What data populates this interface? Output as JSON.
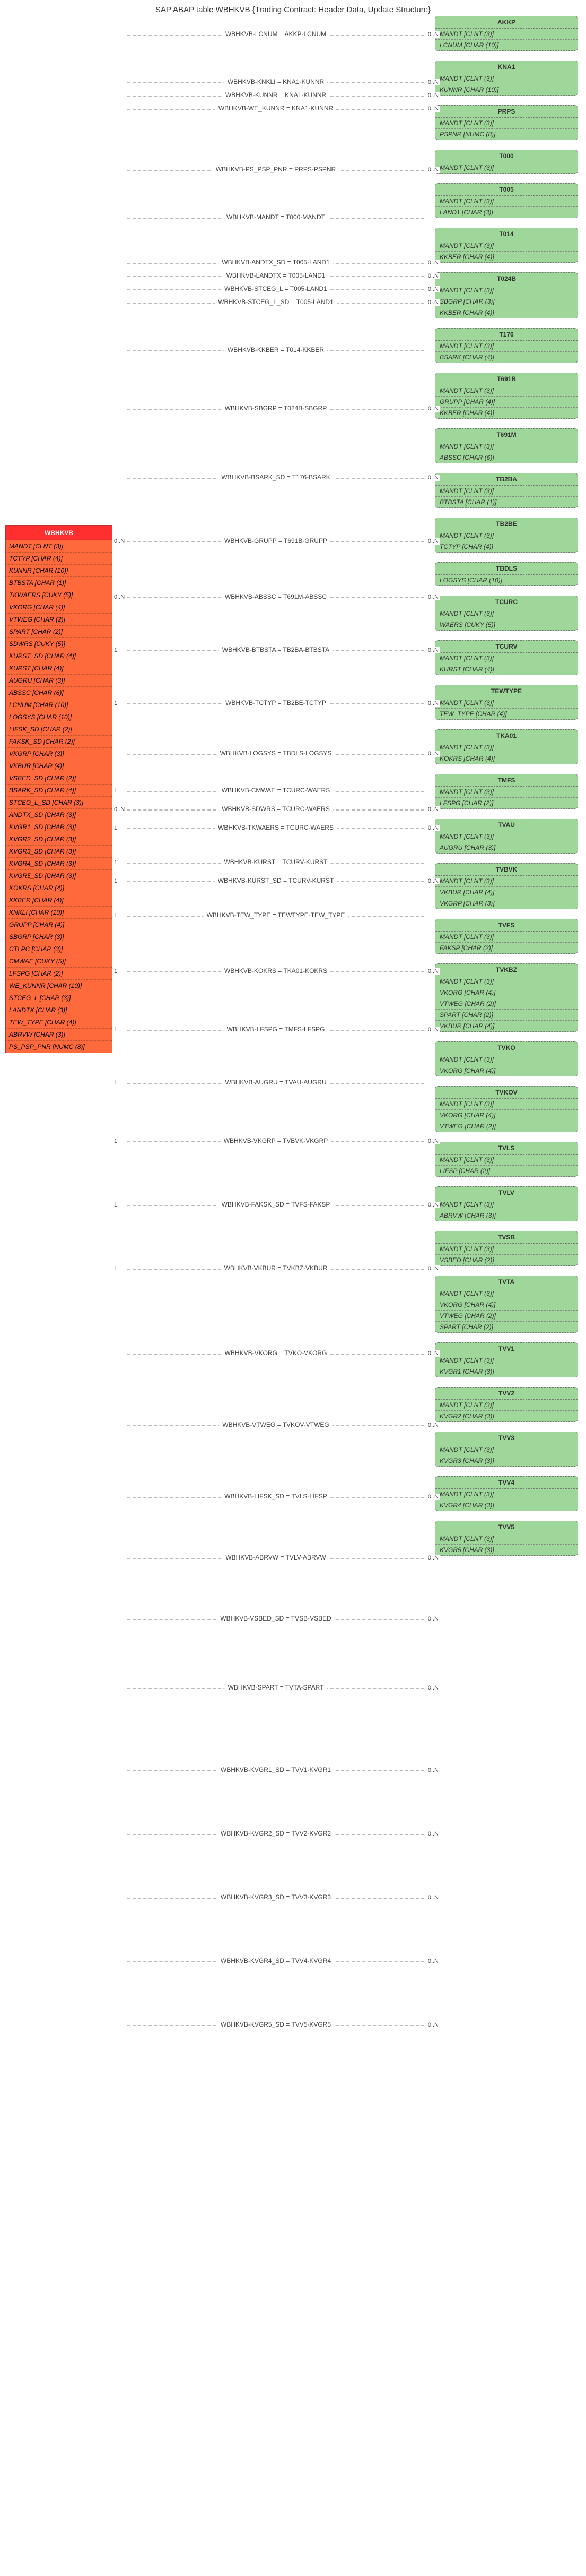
{
  "title": "SAP ABAP table WBHKVB {Trading Contract: Header Data, Update Structure}",
  "source_table": {
    "name": "WBHKVB",
    "fields": [
      "MANDT [CLNT (3)]",
      "TCTYP [CHAR (4)]",
      "KUNNR [CHAR (10)]",
      "BTBSTA [CHAR (1)]",
      "TKWAERS [CUKY (5)]",
      "VKORG [CHAR (4)]",
      "VTWEG [CHAR (2)]",
      "SPART [CHAR (2)]",
      "SDWRS [CUKY (5)]",
      "KURST_SD [CHAR (4)]",
      "KURST [CHAR (4)]",
      "AUGRU [CHAR (3)]",
      "ABSSC [CHAR (6)]",
      "LCNUM [CHAR (10)]",
      "LOGSYS [CHAR (10)]",
      "LIFSK_SD [CHAR (2)]",
      "FAKSK_SD [CHAR (2)]",
      "VKGRP [CHAR (3)]",
      "VKBUR [CHAR (4)]",
      "VSBED_SD [CHAR (2)]",
      "BSARK_SD [CHAR (4)]",
      "STCEG_L_SD [CHAR (3)]",
      "ANDTX_SD [CHAR (3)]",
      "KVGR1_SD [CHAR (3)]",
      "KVGR2_SD [CHAR (3)]",
      "KVGR3_SD [CHAR (3)]",
      "KVGR4_SD [CHAR (3)]",
      "KVGR5_SD [CHAR (3)]",
      "KOKRS [CHAR (4)]",
      "KKBER [CHAR (4)]",
      "KNKLI [CHAR (10)]",
      "GRUPP [CHAR (4)]",
      "SBGRP [CHAR (3)]",
      "CTLPC [CHAR (3)]",
      "CMWAE [CUKY (5)]",
      "LFSPG [CHAR (2)]",
      "WE_KUNNR [CHAR (10)]",
      "STCEG_L [CHAR (3)]",
      "LANDTX [CHAR (3)]",
      "TEW_TYPE [CHAR (4)]",
      "ABRVW [CHAR (3)]",
      "PS_PSP_PNR [NUMC (8)]"
    ]
  },
  "edges": [
    {
      "label": "WBHKVB-LCNUM = AKKP-LCNUM",
      "card_right": "0..N",
      "target": "AKKP"
    },
    {
      "label": "WBHKVB-KNKLI = KNA1-KUNNR",
      "card_right": "0..N",
      "target": "KNA1"
    },
    {
      "label": "WBHKVB-KUNNR = KNA1-KUNNR",
      "card_left": "",
      "card_right": "0..N",
      "target": "KNA1"
    },
    {
      "label": "WBHKVB-WE_KUNNR = KNA1-KUNNR",
      "card_right": "0..N",
      "target": "KNA1"
    },
    {
      "label": "WBHKVB-PS_PSP_PNR = PRPS-PSPNR",
      "card_right": "0..N",
      "target": "PRPS"
    },
    {
      "label": "WBHKVB-MANDT = T000-MANDT",
      "card_right": "",
      "target": "T000"
    },
    {
      "label": "WBHKVB-ANDTX_SD = T005-LAND1",
      "card_right": "0..N",
      "target": "T005"
    },
    {
      "label": "WBHKVB-LANDTX = T005-LAND1",
      "card_right": "0..N",
      "target": "T005"
    },
    {
      "label": "WBHKVB-STCEG_L = T005-LAND1",
      "card_right": "0..N",
      "target": "T005"
    },
    {
      "label": "WBHKVB-STCEG_L_SD = T005-LAND1",
      "card_right": "0..N",
      "target": "T005"
    },
    {
      "label": "WBHKVB-KKBER = T014-KKBER",
      "card_right": "",
      "target": "T014"
    },
    {
      "label": "WBHKVB-SBGRP = T024B-SBGRP",
      "card_right": "0..N",
      "target": "T024B"
    },
    {
      "label": "WBHKVB-BSARK_SD = T176-BSARK",
      "card_right": "0..N",
      "target": "T176"
    },
    {
      "label": "WBHKVB-GRUPP = T691B-GRUPP",
      "card_left": "0..N",
      "card_right": "0..N",
      "target": "T691B"
    },
    {
      "label": "WBHKVB-ABSSC = T691M-ABSSC",
      "card_left": "0..N",
      "card_right": "0..N",
      "target": "T691M"
    },
    {
      "label": "WBHKVB-BTBSTA = TB2BA-BTBSTA",
      "card_left": "1",
      "card_right": "0..N",
      "target": "TB2BA"
    },
    {
      "label": "WBHKVB-TCTYP = TB2BE-TCTYP",
      "card_left": "1",
      "card_right": "0..N",
      "target": "TB2BE"
    },
    {
      "label": "WBHKVB-LOGSYS = TBDLS-LOGSYS",
      "card_left": "",
      "card_right": "0..N",
      "target": "TBDLS"
    },
    {
      "label": "WBHKVB-CMWAE = TCURC-WAERS",
      "card_left": "1",
      "card_right": "",
      "target": "TCURC"
    },
    {
      "label": "WBHKVB-SDWRS = TCURC-WAERS",
      "card_left": "0..N",
      "card_right": "0..N",
      "target": "TCURC"
    },
    {
      "label": "WBHKVB-TKWAERS = TCURC-WAERS",
      "card_left": "1",
      "card_right": "0..N",
      "target": "TCURC"
    },
    {
      "label": "WBHKVB-KURST = TCURV-KURST",
      "card_left": "1",
      "card_right": "",
      "target": "TCURV"
    },
    {
      "label": "WBHKVB-KURST_SD = TCURV-KURST",
      "card_left": "1",
      "card_right": "0..N",
      "target": "TCURV"
    },
    {
      "label": "WBHKVB-TEW_TYPE = TEWTYPE-TEW_TYPE",
      "card_left": "1",
      "card_right": "",
      "target": "TEWTYPE"
    },
    {
      "label": "WBHKVB-KOKRS = TKA01-KOKRS",
      "card_left": "1",
      "card_right": "0..N",
      "target": "TKA01"
    },
    {
      "label": "WBHKVB-LFSPG = TMFS-LFSPG",
      "card_left": "1",
      "card_right": "0..N",
      "target": "TMFS"
    },
    {
      "label": "WBHKVB-AUGRU = TVAU-AUGRU",
      "card_left": "1",
      "card_right": "",
      "target": "TVAU"
    },
    {
      "label": "WBHKVB-VKGRP = TVBVK-VKGRP",
      "card_left": "1",
      "card_right": "0..N",
      "target": "TVBVK"
    },
    {
      "label": "WBHKVB-FAKSK_SD = TVFS-FAKSP",
      "card_left": "1",
      "card_right": "0..N",
      "target": "TVFS"
    },
    {
      "label": "WBHKVB-VKBUR = TVKBZ-VKBUR",
      "card_left": "1",
      "card_right": "0..N",
      "target": "TVKBZ"
    },
    {
      "label": "WBHKVB-VKORG = TVKO-VKORG",
      "card_left": "",
      "card_right": "0..N",
      "target": "TVKO"
    },
    {
      "label": "WBHKVB-VTWEG = TVKOV-VTWEG",
      "card_left": "",
      "card_right": "0..N",
      "target": "TVKOV"
    },
    {
      "label": "WBHKVB-LIFSK_SD = TVLS-LIFSP",
      "card_left": "",
      "card_right": "0..N",
      "target": "TVLS"
    },
    {
      "label": "WBHKVB-ABRVW = TVLV-ABRVW",
      "card_left": "",
      "card_right": "0..N",
      "target": "TVLV"
    },
    {
      "label": "WBHKVB-VSBED_SD = TVSB-VSBED",
      "card_left": "",
      "card_right": "0..N",
      "target": "TVSB"
    },
    {
      "label": "WBHKVB-SPART = TVTA-SPART",
      "card_left": "",
      "card_right": "0..N",
      "target": "TVTA"
    },
    {
      "label": "WBHKVB-KVGR1_SD = TVV1-KVGR1",
      "card_left": "",
      "card_right": "0..N",
      "target": "TVV1"
    },
    {
      "label": "WBHKVB-KVGR2_SD = TVV2-KVGR2",
      "card_left": "",
      "card_right": "0..N",
      "target": "TVV2"
    },
    {
      "label": "WBHKVB-KVGR3_SD = TVV3-KVGR3",
      "card_left": "",
      "card_right": "0..N",
      "target": "TVV3"
    },
    {
      "label": "WBHKVB-KVGR4_SD = TVV4-KVGR4",
      "card_left": "",
      "card_right": "0..N",
      "target": "TVV4"
    },
    {
      "label": "WBHKVB-KVGR5_SD = TVV5-KVGR5",
      "card_left": "",
      "card_right": "0..N",
      "target": "TVV5"
    }
  ],
  "targets": [
    {
      "name": "AKKP",
      "fields": [
        "MANDT [CLNT (3)]",
        "LCNUM [CHAR (10)]"
      ],
      "h": 70
    },
    {
      "name": "KNA1",
      "fields": [
        "MANDT [CLNT (3)]",
        "KUNNR [CHAR (10)]"
      ],
      "h": 70
    },
    {
      "name": "PRPS",
      "fields": [
        "MANDT [CLNT (3)]",
        "PSPNR [NUMC (8)]"
      ],
      "h": 70
    },
    {
      "name": "T000",
      "fields": [
        "MANDT [CLNT (3)]"
      ],
      "h": 50
    },
    {
      "name": "T005",
      "fields": [
        "MANDT [CLNT (3)]",
        "LAND1 [CHAR (3)]"
      ],
      "h": 70
    },
    {
      "name": "T014",
      "fields": [
        "MANDT [CLNT (3)]",
        "KKBER [CHAR (4)]"
      ],
      "h": 70
    },
    {
      "name": "T024B",
      "fields": [
        "MANDT [CLNT (3)]",
        "SBGRP [CHAR (3)]",
        "KKBER [CHAR (4)]"
      ],
      "h": 90
    },
    {
      "name": "T176",
      "fields": [
        "MANDT [CLNT (3)]",
        "BSARK [CHAR (4)]"
      ],
      "h": 70
    },
    {
      "name": "T691B",
      "fields": [
        "MANDT [CLNT (3)]",
        "GRUPP [CHAR (4)]",
        "KKBER [CHAR (4)]"
      ],
      "h": 90
    },
    {
      "name": "T691M",
      "fields": [
        "MANDT [CLNT (3)]",
        "ABSSC [CHAR (6)]"
      ],
      "h": 70
    },
    {
      "name": "TB2BA",
      "fields": [
        "MANDT [CLNT (3)]",
        "BTBSTA [CHAR (1)]"
      ],
      "h": 70
    },
    {
      "name": "TB2BE",
      "fields": [
        "MANDT [CLNT (3)]",
        "TCTYP [CHAR (4)]"
      ],
      "h": 70
    },
    {
      "name": "TBDLS",
      "fields": [
        "LOGSYS [CHAR (10)]"
      ],
      "h": 50
    },
    {
      "name": "TCURC",
      "fields": [
        "MANDT [CLNT (3)]",
        "WAERS [CUKY (5)]"
      ],
      "h": 70
    },
    {
      "name": "TCURV",
      "fields": [
        "MANDT [CLNT (3)]",
        "KURST [CHAR (4)]"
      ],
      "h": 70
    },
    {
      "name": "TEWTYPE",
      "fields": [
        "MANDT [CLNT (3)]",
        "TEW_TYPE [CHAR (4)]"
      ],
      "h": 70
    },
    {
      "name": "TKA01",
      "fields": [
        "MANDT [CLNT (3)]",
        "KOKRS [CHAR (4)]"
      ],
      "h": 70
    },
    {
      "name": "TMFS",
      "fields": [
        "MANDT [CLNT (3)]",
        "LFSPG [CHAR (2)]"
      ],
      "h": 70
    },
    {
      "name": "TVAU",
      "fields": [
        "MANDT [CLNT (3)]",
        "AUGRU [CHAR (3)]"
      ],
      "h": 70
    },
    {
      "name": "TVBVK",
      "fields": [
        "MANDT [CLNT (3)]",
        "VKBUR [CHAR (4)]",
        "VKGRP [CHAR (3)]"
      ],
      "h": 90
    },
    {
      "name": "TVFS",
      "fields": [
        "MANDT [CLNT (3)]",
        "FAKSP [CHAR (2)]"
      ],
      "h": 70
    },
    {
      "name": "TVKBZ",
      "fields": [
        "MANDT [CLNT (3)]",
        "VKORG [CHAR (4)]",
        "VTWEG [CHAR (2)]",
        "SPART [CHAR (2)]",
        "VKBUR [CHAR (4)]"
      ],
      "h": 130
    },
    {
      "name": "TVKO",
      "fields": [
        "MANDT [CLNT (3)]",
        "VKORG [CHAR (4)]"
      ],
      "h": 70
    },
    {
      "name": "TVKOV",
      "fields": [
        "MANDT [CLNT (3)]",
        "VKORG [CHAR (4)]",
        "VTWEG [CHAR (2)]"
      ],
      "h": 90
    },
    {
      "name": "TVLS",
      "fields": [
        "MANDT [CLNT (3)]",
        "LIFSP [CHAR (2)]"
      ],
      "h": 70
    },
    {
      "name": "TVLV",
      "fields": [
        "MANDT [CLNT (3)]",
        "ABRVW [CHAR (3)]"
      ],
      "h": 70
    },
    {
      "name": "TVSB",
      "fields": [
        "MANDT [CLNT (3)]",
        "VSBED [CHAR (2)]"
      ],
      "h": 70
    },
    {
      "name": "TVTA",
      "fields": [
        "MANDT [CLNT (3)]",
        "VKORG [CHAR (4)]",
        "VTWEG [CHAR (2)]",
        "SPART [CHAR (2)]"
      ],
      "h": 110
    },
    {
      "name": "TVV1",
      "fields": [
        "MANDT [CLNT (3)]",
        "KVGR1 [CHAR (3)]"
      ],
      "h": 70
    },
    {
      "name": "TVV2",
      "fields": [
        "MANDT [CLNT (3)]",
        "KVGR2 [CHAR (3)]"
      ],
      "h": 70
    },
    {
      "name": "TVV3",
      "fields": [
        "MANDT [CLNT (3)]",
        "KVGR3 [CHAR (3)]"
      ],
      "h": 70
    },
    {
      "name": "TVV4",
      "fields": [
        "MANDT [CLNT (3)]",
        "KVGR4 [CHAR (3)]"
      ],
      "h": 70
    },
    {
      "name": "TVV5",
      "fields": [
        "MANDT [CLNT (3)]",
        "KVGR5 [CHAR (3)]"
      ],
      "h": 70
    }
  ],
  "edge_target_vpos": [
    35,
    125,
    150,
    175,
    290,
    380,
    465,
    490,
    515,
    540,
    630,
    740,
    870,
    990,
    1095,
    1195,
    1295,
    1390,
    1460,
    1495,
    1530,
    1595,
    1630,
    1695,
    1800,
    1910,
    2010,
    2120,
    2240,
    2360,
    2520,
    2655,
    2790,
    2905,
    3020,
    3150,
    3305,
    3425,
    3545,
    3665,
    3785
  ]
}
